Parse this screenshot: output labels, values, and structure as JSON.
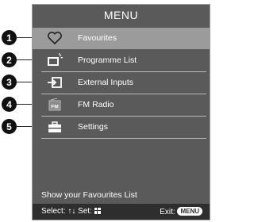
{
  "menu": {
    "title": "MENU",
    "items": [
      {
        "label": "Favourites",
        "icon": "heart-icon",
        "number": "1",
        "selected": true
      },
      {
        "label": "Programme List",
        "icon": "tv-list-icon",
        "number": "2",
        "selected": false
      },
      {
        "label": "External Inputs",
        "icon": "input-icon",
        "number": "3",
        "selected": false
      },
      {
        "label": "FM Radio",
        "icon": "radio-icon",
        "number": "4",
        "selected": false
      },
      {
        "label": "Settings",
        "icon": "toolbox-icon",
        "number": "5",
        "selected": false
      }
    ],
    "hint": "Show your Favourites List",
    "footer": {
      "select_label": "Select:",
      "set_label": "Set:",
      "exit_label": "Exit:",
      "menu_button": "MENU"
    }
  },
  "colors": {
    "panel": "#5a5a5a",
    "selected_row": "#9b9b9b",
    "footer": "#2e2e2e",
    "callout": "#111111"
  }
}
